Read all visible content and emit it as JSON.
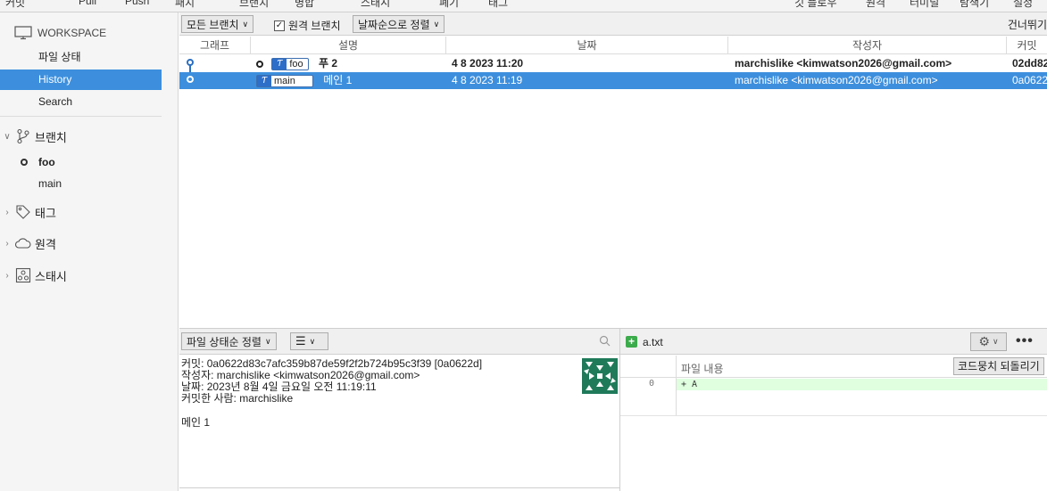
{
  "toolbar": {
    "items": [
      "커밋",
      "Pull",
      "Push",
      "패치",
      "브랜치",
      "병합",
      "스태시",
      "폐기",
      "태그",
      "깃 플로우",
      "원격",
      "터미널",
      "탐색기",
      "설정"
    ]
  },
  "sidebar": {
    "workspace_label": "WORKSPACE",
    "workspace_items": [
      {
        "label": "파일 상태",
        "selected": false
      },
      {
        "label": "History",
        "selected": true
      },
      {
        "label": "Search",
        "selected": false
      }
    ],
    "branches_label": "브랜치",
    "branches": [
      {
        "name": "foo",
        "current": true
      },
      {
        "name": "main",
        "current": false
      }
    ],
    "tags_label": "태그",
    "remotes_label": "원격",
    "stashes_label": "스태시"
  },
  "filter_bar": {
    "branch_filter": "모든 브랜치",
    "remote_branches_label": "원격 브랜치",
    "remote_branches_checked": true,
    "sort": "날짜순으로 정렬",
    "skip_label": "건너뛰기"
  },
  "history": {
    "columns": {
      "graph": "그래프",
      "description": "설명",
      "date": "날짜",
      "author": "작성자",
      "commit": "커밋"
    },
    "rows": [
      {
        "branch": "foo",
        "message": "푸 2",
        "date": "4 8 2023 11:20",
        "author": "marchislike <kimwatson2026@gmail.com>",
        "commit": "02dd82",
        "selected": false,
        "bold": true
      },
      {
        "branch": "main",
        "message": "메인 1",
        "date": "4 8 2023 11:19",
        "author": "marchislike <kimwatson2026@gmail.com>",
        "commit": "0a0622",
        "selected": true,
        "bold": false
      }
    ]
  },
  "detail": {
    "sort_label": "파일 상태순 정렬",
    "view_mode_icon": "list-icon",
    "commit_line": "커밋: 0a0622d83c7afc359b87de59f2f2b724b95c3f39 [0a0622d]",
    "author_line": "작성자: marchislike <kimwatson2026@gmail.com>",
    "date_line": "날짜: 2023년 8월 4일 금요일 오전 11:19:11",
    "committer_line": "커밋한 사람: marchislike",
    "message": "메인 1"
  },
  "diff": {
    "file_name": "a.txt",
    "file_status_icon": "added-file-icon",
    "hunk_label": "파일 내용",
    "revert_label": "코드뭉치 되돌리기",
    "more_label": "•••",
    "lines": [
      {
        "old_no": "0",
        "text": "+ A"
      }
    ]
  },
  "colors": {
    "selection": "#3d8fdd",
    "added_line": "#dfffdf",
    "graph": "#2b6fc2"
  }
}
